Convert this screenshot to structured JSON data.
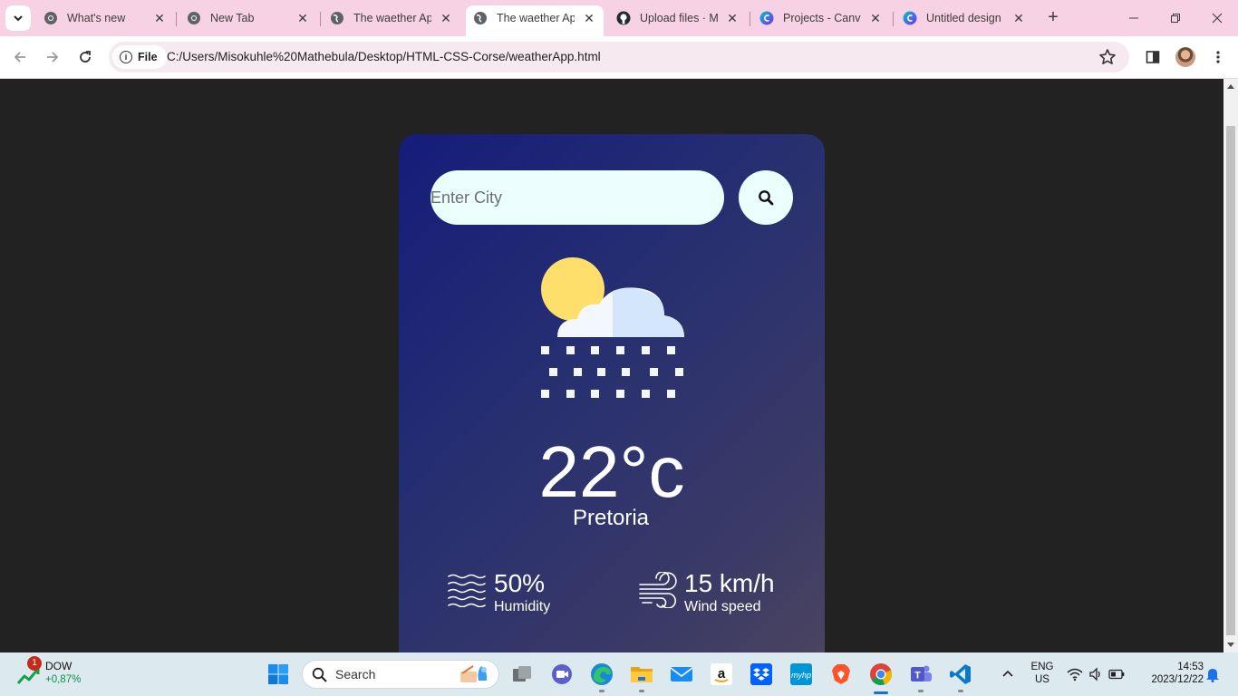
{
  "browser": {
    "tabs": [
      {
        "title": "What's new",
        "favicon": "chrome-icon",
        "active": false
      },
      {
        "title": "New Tab",
        "favicon": "chrome-icon",
        "active": false
      },
      {
        "title": "The waether App",
        "favicon": "globe-icon",
        "active": false
      },
      {
        "title": "The waether App",
        "favicon": "globe-icon",
        "active": true
      },
      {
        "title": "Upload files · Mathebula",
        "favicon": "github-icon",
        "active": false
      },
      {
        "title": "Projects - Canva",
        "favicon": "canva-icon",
        "active": false
      },
      {
        "title": "Untitled design - Canva",
        "favicon": "canva-icon",
        "active": false
      }
    ],
    "site_info_label": "File",
    "url": "C:/Users/Misokuhle%20Mathebula/Desktop/HTML-CSS-Corse/weatherApp.html",
    "tabstrip_color": "#f7d2e4"
  },
  "app": {
    "search_placeholder": "Enter City",
    "temperature": "22°c",
    "city": "Pretoria",
    "humidity_value": "50%",
    "humidity_label": "Humidity",
    "wind_value": "15 km/h",
    "wind_label": "Wind speed",
    "weather_icon": "snow-cloud-sun-icon"
  },
  "taskbar": {
    "widget_name": "DOW",
    "widget_change": "+0,87%",
    "widget_badge": "1",
    "search_label": "Search",
    "apps": [
      "start",
      "search",
      "task-view",
      "teams-meet",
      "edge",
      "file-explorer",
      "mail",
      "amazon",
      "dropbox",
      "myhp",
      "brave",
      "chrome",
      "teams",
      "vscode"
    ],
    "lang_top": "ENG",
    "lang_bottom": "US",
    "time": "14:53",
    "date": "2023/12/22"
  }
}
